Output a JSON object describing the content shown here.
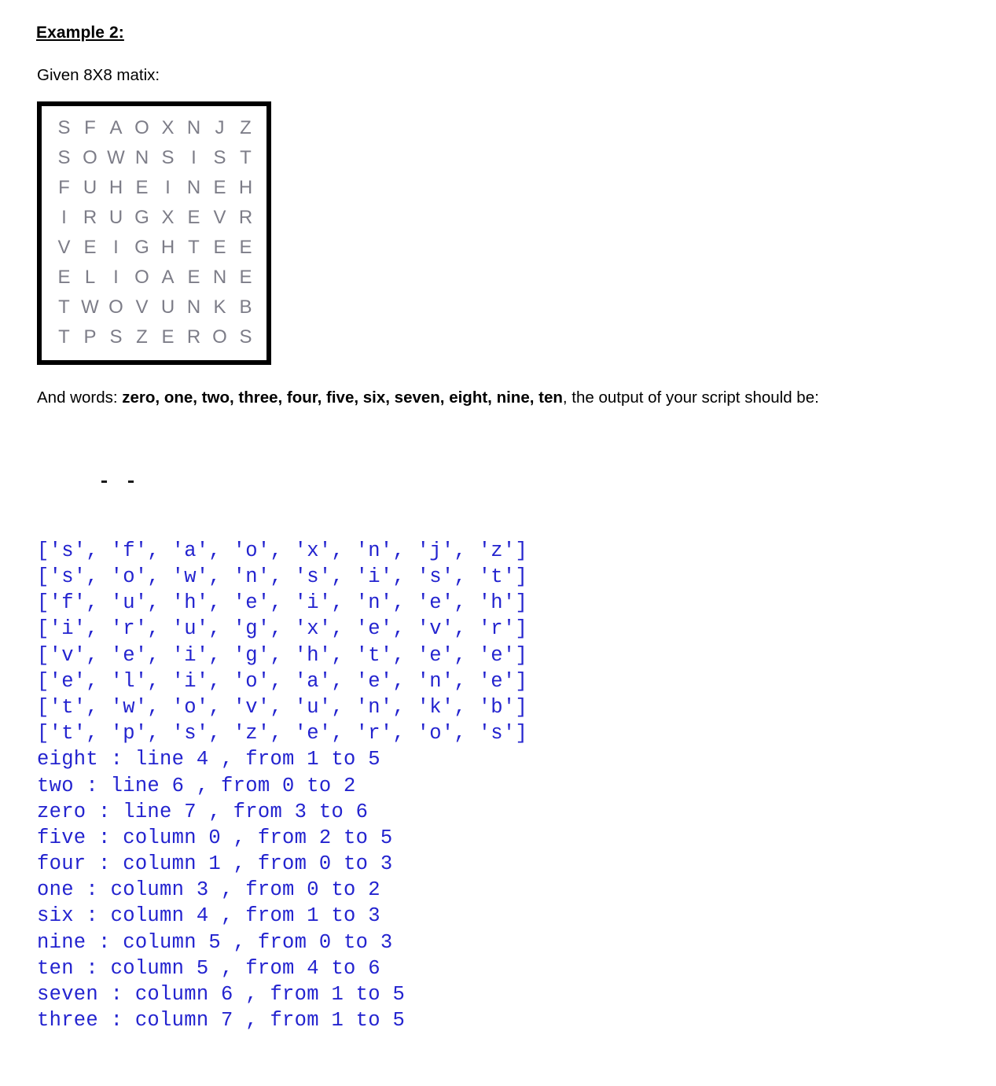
{
  "document": {
    "heading": "Example 2:",
    "subtext": "Given 8X8 matix:",
    "matrix": {
      "rows": [
        [
          "S",
          "F",
          "A",
          "O",
          "X",
          "N",
          "J",
          "Z"
        ],
        [
          "S",
          "O",
          "W",
          "N",
          "S",
          "I",
          "S",
          "T"
        ],
        [
          "F",
          "U",
          "H",
          "E",
          "I",
          "N",
          "E",
          "H"
        ],
        [
          "I",
          "R",
          "U",
          "G",
          "X",
          "E",
          "V",
          "R"
        ],
        [
          "V",
          "E",
          "I",
          "G",
          "H",
          "T",
          "E",
          "E"
        ],
        [
          "E",
          "L",
          "I",
          "O",
          "A",
          "E",
          "N",
          "E"
        ],
        [
          "T",
          "W",
          "O",
          "V",
          "U",
          "N",
          "K",
          "B"
        ],
        [
          "T",
          "P",
          "S",
          "Z",
          "E",
          "R",
          "O",
          "S"
        ]
      ],
      "letter_color": "#7d7d88",
      "border_color": "#000000"
    },
    "words_paragraph": {
      "prefix": "And words: ",
      "words": [
        "zero",
        "one",
        "two",
        "three",
        "four",
        "five",
        "six",
        "seven",
        "eight",
        "nine",
        "ten"
      ],
      "suffix": ", the output of your script should be:"
    },
    "output": {
      "color": "#2323cf",
      "dash_marker": "- -",
      "matrix_lines": [
        "['s', 'f', 'a', 'o', 'x', 'n', 'j', 'z']",
        "['s', 'o', 'w', 'n', 's', 'i', 's', 't']",
        "['f', 'u', 'h', 'e', 'i', 'n', 'e', 'h']",
        "['i', 'r', 'u', 'g', 'x', 'e', 'v', 'r']",
        "['v', 'e', 'i', 'g', 'h', 't', 'e', 'e']",
        "['e', 'l', 'i', 'o', 'a', 'e', 'n', 'e']",
        "['t', 'w', 'o', 'v', 'u', 'n', 'k', 'b']",
        "['t', 'p', 's', 'z', 'e', 'r', 'o', 's']"
      ],
      "result_lines": [
        "eight : line 4 , from 1 to 5",
        "two : line 6 , from 0 to 2",
        "zero : line 7 , from 3 to 6",
        "five : column 0 , from 2 to 5",
        "four : column 1 , from 0 to 3",
        "one : column 3 , from 0 to 2",
        "six : column 4 , from 1 to 3",
        "nine : column 5 , from 0 to 3",
        "ten : column 5 , from 4 to 6",
        "seven : column 6 , from 1 to 5",
        "three : column 7 , from 1 to 5"
      ]
    }
  }
}
